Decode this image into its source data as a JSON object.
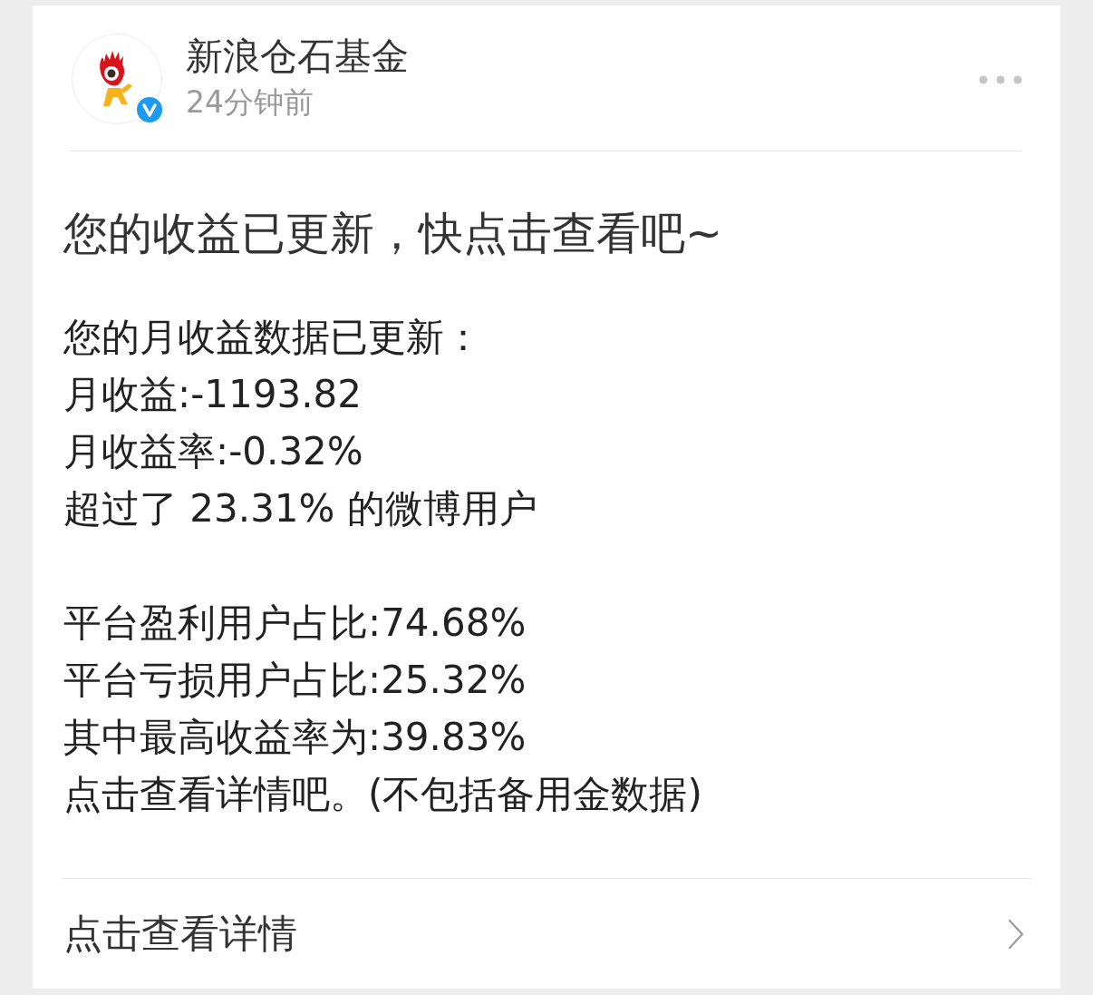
{
  "post": {
    "author": {
      "name": "新浪仓石基金",
      "verified": true
    },
    "time": "24分钟前",
    "title": "您的收益已更新，快点击查看吧~",
    "paragraphs": [
      [
        "您的月收益数据已更新：",
        "月收益:-1193.82",
        "月收益率:-0.32%",
        "超过了 23.31% 的微博用户"
      ],
      [
        "平台盈利用户占比:74.68%",
        "平台亏损用户占比:25.32%",
        "其中最高收益率为:39.83%",
        "点击查看详情吧。(不包括备用金数据)"
      ]
    ]
  },
  "link": {
    "label": "点击查看详情"
  }
}
